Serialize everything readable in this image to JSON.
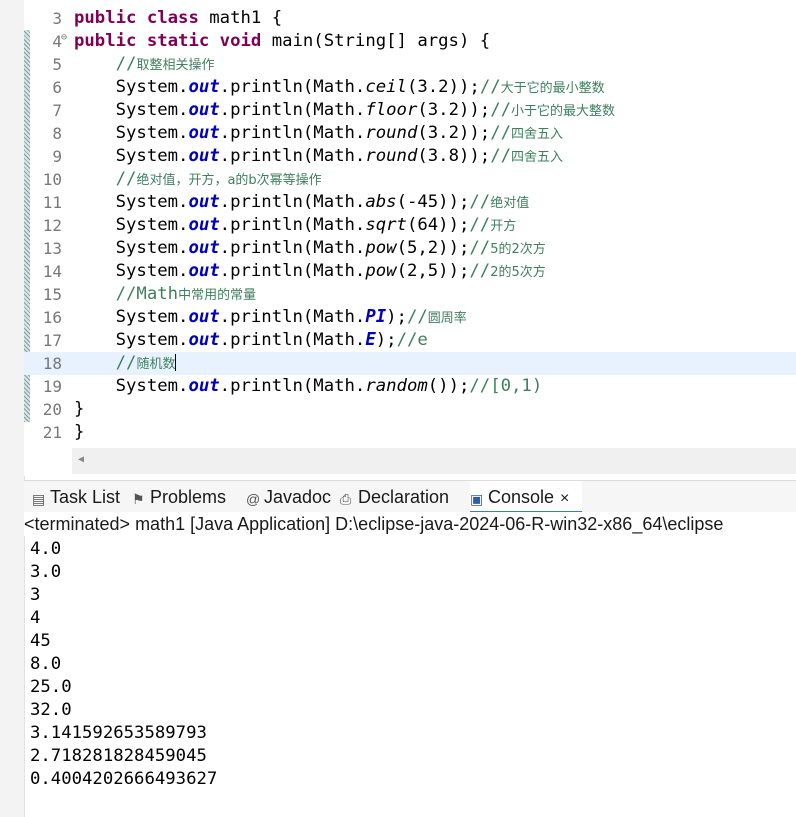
{
  "editor": {
    "lines": [
      {
        "n": "3",
        "tokens": [
          {
            "t": "public class ",
            "c": "kw"
          },
          {
            "t": "math1 {"
          }
        ]
      },
      {
        "n": "4",
        "fold": "⊖",
        "tokens": [
          {
            "t": "public static void ",
            "c": "kw"
          },
          {
            "t": "main(String[] args) {"
          }
        ]
      },
      {
        "n": "5",
        "tokens": [
          {
            "t": "    "
          },
          {
            "t": "//",
            "c": "cmt"
          },
          {
            "t": "取整相关操作",
            "c": "cmt-cn"
          }
        ]
      },
      {
        "n": "6",
        "changed": true,
        "tokens": [
          {
            "t": "    System."
          },
          {
            "t": "out",
            "c": "fld"
          },
          {
            "t": ".println(Math."
          },
          {
            "t": "ceil",
            "c": "mth"
          },
          {
            "t": "(3.2));"
          },
          {
            "t": "//",
            "c": "cmt"
          },
          {
            "t": "大于它的最小整数",
            "c": "cmt-cn"
          }
        ]
      },
      {
        "n": "7",
        "changed": true,
        "tokens": [
          {
            "t": "    System."
          },
          {
            "t": "out",
            "c": "fld"
          },
          {
            "t": ".println(Math."
          },
          {
            "t": "floor",
            "c": "mth"
          },
          {
            "t": "(3.2));"
          },
          {
            "t": "//",
            "c": "cmt"
          },
          {
            "t": "小于它的最大整数",
            "c": "cmt-cn"
          }
        ]
      },
      {
        "n": "8",
        "changed": true,
        "tokens": [
          {
            "t": "    System."
          },
          {
            "t": "out",
            "c": "fld"
          },
          {
            "t": ".println(Math."
          },
          {
            "t": "round",
            "c": "mth"
          },
          {
            "t": "(3.2));"
          },
          {
            "t": "//",
            "c": "cmt"
          },
          {
            "t": "四舍五入",
            "c": "cmt-cn"
          }
        ]
      },
      {
        "n": "9",
        "changed": true,
        "tokens": [
          {
            "t": "    System."
          },
          {
            "t": "out",
            "c": "fld"
          },
          {
            "t": ".println(Math."
          },
          {
            "t": "round",
            "c": "mth"
          },
          {
            "t": "(3.8));"
          },
          {
            "t": "//",
            "c": "cmt"
          },
          {
            "t": "四舍五入",
            "c": "cmt-cn"
          }
        ]
      },
      {
        "n": "10",
        "changed": true,
        "tokens": [
          {
            "t": "    "
          },
          {
            "t": "//",
            "c": "cmt"
          },
          {
            "t": "绝对值，开方，a的b次幂等操作",
            "c": "cmt-cn"
          }
        ]
      },
      {
        "n": "11",
        "changed": true,
        "tokens": [
          {
            "t": "    System."
          },
          {
            "t": "out",
            "c": "fld"
          },
          {
            "t": ".println(Math."
          },
          {
            "t": "abs",
            "c": "mth"
          },
          {
            "t": "(-45));"
          },
          {
            "t": "//",
            "c": "cmt"
          },
          {
            "t": "绝对值",
            "c": "cmt-cn"
          }
        ]
      },
      {
        "n": "12",
        "changed": true,
        "tokens": [
          {
            "t": "    System."
          },
          {
            "t": "out",
            "c": "fld"
          },
          {
            "t": ".println(Math."
          },
          {
            "t": "sqrt",
            "c": "mth"
          },
          {
            "t": "(64));"
          },
          {
            "t": "//",
            "c": "cmt"
          },
          {
            "t": "开方",
            "c": "cmt-cn"
          }
        ]
      },
      {
        "n": "13",
        "changed": true,
        "tokens": [
          {
            "t": "    System."
          },
          {
            "t": "out",
            "c": "fld"
          },
          {
            "t": ".println(Math."
          },
          {
            "t": "pow",
            "c": "mth"
          },
          {
            "t": "(5,2));"
          },
          {
            "t": "//",
            "c": "cmt"
          },
          {
            "t": "5的2次方",
            "c": "cmt-cn"
          }
        ]
      },
      {
        "n": "14",
        "changed": true,
        "tokens": [
          {
            "t": "    System."
          },
          {
            "t": "out",
            "c": "fld"
          },
          {
            "t": ".println(Math."
          },
          {
            "t": "pow",
            "c": "mth"
          },
          {
            "t": "(2,5));"
          },
          {
            "t": "//",
            "c": "cmt"
          },
          {
            "t": "2的5次方",
            "c": "cmt-cn"
          }
        ]
      },
      {
        "n": "15",
        "changed": true,
        "tokens": [
          {
            "t": "    "
          },
          {
            "t": "//Math",
            "c": "cmt"
          },
          {
            "t": "中常用的常量",
            "c": "cmt-cn"
          }
        ]
      },
      {
        "n": "16",
        "changed": true,
        "tokens": [
          {
            "t": "    System."
          },
          {
            "t": "out",
            "c": "fld"
          },
          {
            "t": ".println(Math."
          },
          {
            "t": "PI",
            "c": "fld"
          },
          {
            "t": ");"
          },
          {
            "t": "//",
            "c": "cmt"
          },
          {
            "t": "圆周率",
            "c": "cmt-cn"
          }
        ]
      },
      {
        "n": "17",
        "changed": true,
        "tokens": [
          {
            "t": "    System."
          },
          {
            "t": "out",
            "c": "fld"
          },
          {
            "t": ".println(Math."
          },
          {
            "t": "E",
            "c": "fld"
          },
          {
            "t": ");"
          },
          {
            "t": "//e",
            "c": "cmt"
          }
        ]
      },
      {
        "n": "18",
        "changed": true,
        "current": true,
        "caret": true,
        "tokens": [
          {
            "t": "    "
          },
          {
            "t": "//",
            "c": "cmt"
          },
          {
            "t": "随机数",
            "c": "cmt-cn"
          }
        ]
      },
      {
        "n": "19",
        "changed": true,
        "tokens": [
          {
            "t": "    System."
          },
          {
            "t": "out",
            "c": "fld"
          },
          {
            "t": ".println(Math."
          },
          {
            "t": "random",
            "c": "mth"
          },
          {
            "t": "());"
          },
          {
            "t": "//[0,1)",
            "c": "cmt"
          }
        ]
      },
      {
        "n": "20",
        "changed": true,
        "tokens": [
          {
            "t": "}"
          }
        ]
      },
      {
        "n": "21",
        "tokens": [
          {
            "t": "}"
          }
        ]
      }
    ]
  },
  "tabs": [
    {
      "label": "Task List",
      "icon": "task-list-icon"
    },
    {
      "label": "Problems",
      "icon": "problems-icon"
    },
    {
      "label": "Javadoc",
      "icon": "javadoc-icon"
    },
    {
      "label": "Declaration",
      "icon": "declaration-icon"
    },
    {
      "label": "Console",
      "icon": "console-icon",
      "active": true,
      "close": "×"
    }
  ],
  "console": {
    "header": "<terminated> math1 [Java Application] D:\\eclipse-java-2024-06-R-win32-x86_64\\eclipse",
    "output": [
      "4.0",
      "3.0",
      "3",
      "4",
      "45",
      "8.0",
      "25.0",
      "32.0",
      "3.141592653589793",
      "2.718281828459045",
      "0.4004202666493627"
    ]
  },
  "colors": {
    "keyword": "#7f0055",
    "field": "#0000c0",
    "comment": "#3f7f5f",
    "current_line": "#e8f2fe"
  }
}
